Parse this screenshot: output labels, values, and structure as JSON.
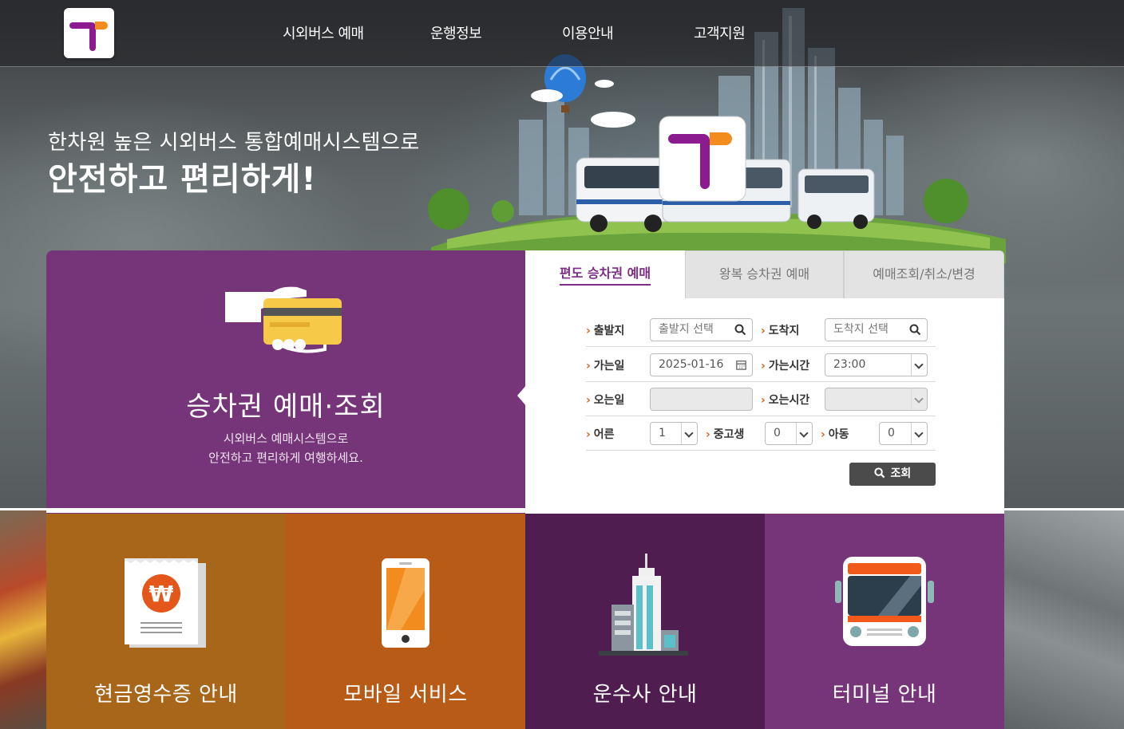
{
  "nav": {
    "items": [
      "시외버스 예매",
      "운행정보",
      "이용안내",
      "고객지원"
    ]
  },
  "hero": {
    "subtitle": "한차원 높은 시외버스 통합예매시스템으로",
    "title": "안전하고 편리하게!"
  },
  "booking_intro": {
    "title": "승차권 예매·조회",
    "desc_line1": "시외버스 예매시스템으로",
    "desc_line2": "안전하고 편리하게 여행하세요."
  },
  "tabs": [
    "편도 승차권 예매",
    "왕복 승차권 예매",
    "예매조회/취소/변경"
  ],
  "form": {
    "departure_label": "출발지",
    "departure_placeholder": "출발지 선택",
    "arrival_label": "도착지",
    "arrival_placeholder": "도착지 선택",
    "go_date_label": "가는일",
    "go_date_value": "2025-01-16",
    "go_time_label": "가는시간",
    "go_time_value": "23:00",
    "return_date_label": "오는일",
    "return_time_label": "오는시간",
    "adult_label": "어른",
    "adult_value": "1",
    "student_label": "중고생",
    "student_value": "0",
    "child_label": "아동",
    "child_value": "0",
    "search_label": "조회"
  },
  "tiles": [
    {
      "label": "현금영수증 안내",
      "color": "#a8661b"
    },
    {
      "label": "모바일 서비스",
      "color": "#b85b17"
    },
    {
      "label": "운수사 안내",
      "color": "#4f1d4f"
    },
    {
      "label": "터미널 안내",
      "color": "#773579"
    }
  ],
  "colors": {
    "brand_purple": "#773579",
    "brand_orange": "#f28c1e",
    "accent_text": "#7a2d82"
  }
}
